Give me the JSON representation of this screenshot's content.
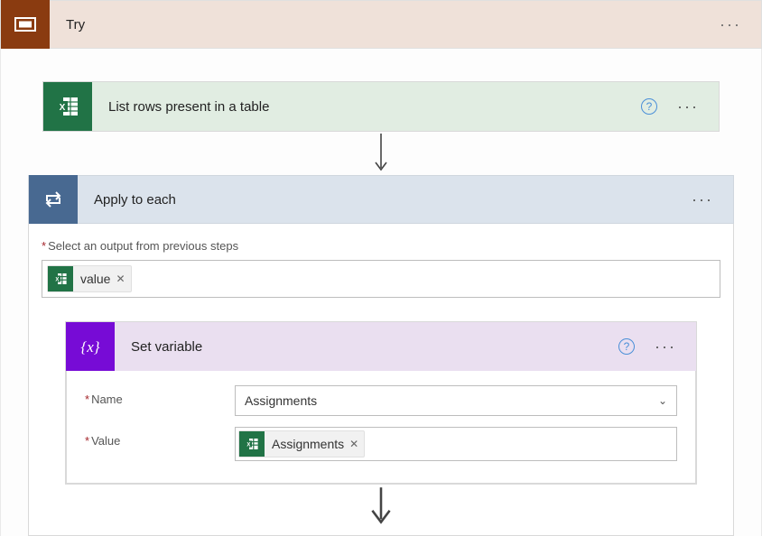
{
  "try": {
    "title": "Try"
  },
  "listRows": {
    "title": "List rows present in a table"
  },
  "applyToEach": {
    "title": "Apply to each",
    "outputLabel": "Select an output from previous steps",
    "tokenLabel": "value"
  },
  "setVariable": {
    "title": "Set variable",
    "nameLabel": "Name",
    "valueLabel": "Value",
    "nameValue": "Assignments",
    "tokenLabel": "Assignments"
  }
}
